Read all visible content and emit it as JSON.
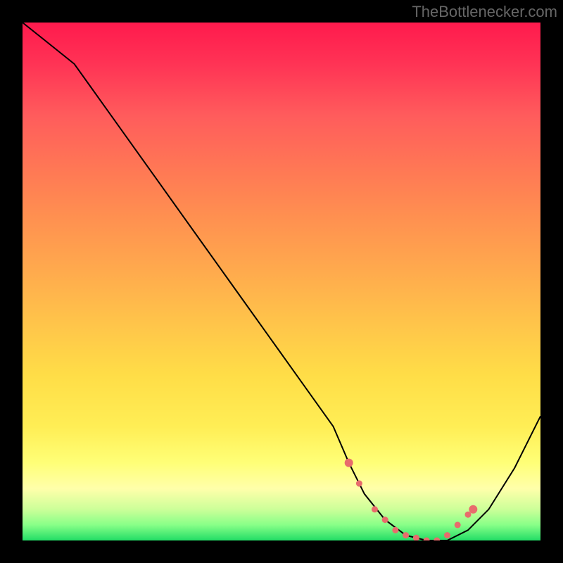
{
  "watermark": "TheBottlenecker.com",
  "chart_data": {
    "type": "line",
    "title": "",
    "xlabel": "",
    "ylabel": "",
    "xlim": [
      0,
      100
    ],
    "ylim": [
      0,
      100
    ],
    "series": [
      {
        "name": "bottleneck-curve",
        "x": [
          0,
          5,
          10,
          15,
          20,
          25,
          30,
          35,
          40,
          45,
          50,
          55,
          60,
          63,
          66,
          70,
          74,
          78,
          82,
          86,
          90,
          95,
          100
        ],
        "values": [
          100,
          96,
          92,
          85,
          78,
          71,
          64,
          57,
          50,
          43,
          36,
          29,
          22,
          15,
          9,
          4,
          1,
          0,
          0,
          2,
          6,
          14,
          24
        ]
      }
    ],
    "markers": {
      "name": "highlight-dots",
      "color": "#e86c6c",
      "x": [
        63,
        65,
        68,
        70,
        72,
        74,
        76,
        78,
        80,
        82,
        84,
        86,
        87
      ],
      "values": [
        15,
        11,
        6,
        4,
        2,
        1,
        0.5,
        0,
        0,
        1,
        3,
        5,
        6
      ]
    }
  }
}
